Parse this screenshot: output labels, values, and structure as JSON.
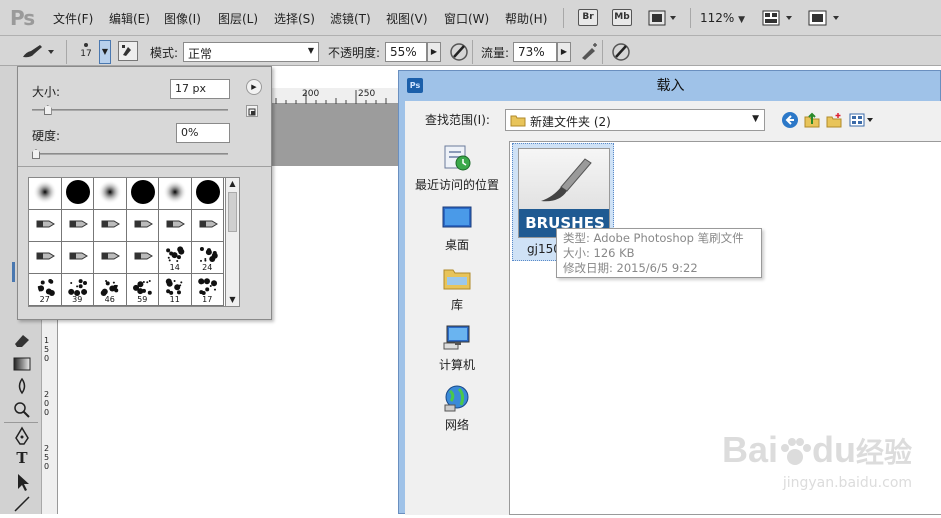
{
  "app": {
    "logo": "Ps"
  },
  "menu": {
    "items": [
      "文件(F)",
      "编辑(E)",
      "图像(I)",
      "图层(L)",
      "选择(S)",
      "滤镜(T)",
      "视图(V)",
      "窗口(W)",
      "帮助(H)"
    ],
    "br_label": "Br",
    "mb_label": "Mb",
    "zoom": "112%"
  },
  "options": {
    "brush_size": "17",
    "mode_label": "模式:",
    "mode_value": "正常",
    "opacity_label": "不透明度:",
    "opacity_value": "55%",
    "flow_label": "流量:",
    "flow_value": "73%"
  },
  "brush_popup": {
    "size_label": "大小:",
    "size_value": "17 px",
    "hardness_label": "硬度:",
    "hardness_value": "0%",
    "size_level": 0.06,
    "hardness_level": 0.0,
    "presets": [
      {
        "shape": "soft",
        "num": ""
      },
      {
        "shape": "hard",
        "num": ""
      },
      {
        "shape": "soft",
        "num": ""
      },
      {
        "shape": "hard",
        "num": ""
      },
      {
        "shape": "soft",
        "num": ""
      },
      {
        "shape": "hard",
        "num": ""
      },
      {
        "shape": "tip",
        "num": ""
      },
      {
        "shape": "tip",
        "num": ""
      },
      {
        "shape": "tip",
        "num": ""
      },
      {
        "shape": "tip",
        "num": ""
      },
      {
        "shape": "tip",
        "num": ""
      },
      {
        "shape": "tip",
        "num": ""
      },
      {
        "shape": "tip",
        "num": ""
      },
      {
        "shape": "tip",
        "num": ""
      },
      {
        "shape": "tip",
        "num": ""
      },
      {
        "shape": "tip",
        "num": ""
      },
      {
        "shape": "splat",
        "num": "14"
      },
      {
        "shape": "splat",
        "num": "24"
      },
      {
        "shape": "splat",
        "num": "27"
      },
      {
        "shape": "splat",
        "num": "39"
      },
      {
        "shape": "splat",
        "num": "46"
      },
      {
        "shape": "splat",
        "num": "59"
      },
      {
        "shape": "splat",
        "num": "11"
      },
      {
        "shape": "splat",
        "num": "17"
      }
    ]
  },
  "ruler": {
    "h_ticks": [
      "200",
      "250"
    ],
    "v_ticks": [
      "1",
      "5",
      "0",
      "2",
      "0",
      "0",
      "2",
      "5",
      "0"
    ]
  },
  "dialog": {
    "title": "载入",
    "lookin_label": "查找范围(I):",
    "folder": "新建文件夹 (2)",
    "places": [
      "最近访问的位置",
      "桌面",
      "库",
      "计算机",
      "网络"
    ],
    "file": {
      "thumb_text": "BRUSHES",
      "name": "gj1506"
    },
    "tooltip": {
      "type": "类型: Adobe Photoshop 笔刷文件",
      "size": "大小: 126 KB",
      "date": "修改日期: 2015/6/5 9:22"
    }
  },
  "watermark": {
    "brand": "Bai",
    "brand_tail": "du",
    "cn": "经验",
    "url": "jingyan.baidu.com"
  },
  "colors": {
    "chrome": "#d6d6d6",
    "dialog_frame": "#9fc2e8",
    "selection": "#cfe2f6",
    "brushes_banner": "#1f5a92"
  }
}
